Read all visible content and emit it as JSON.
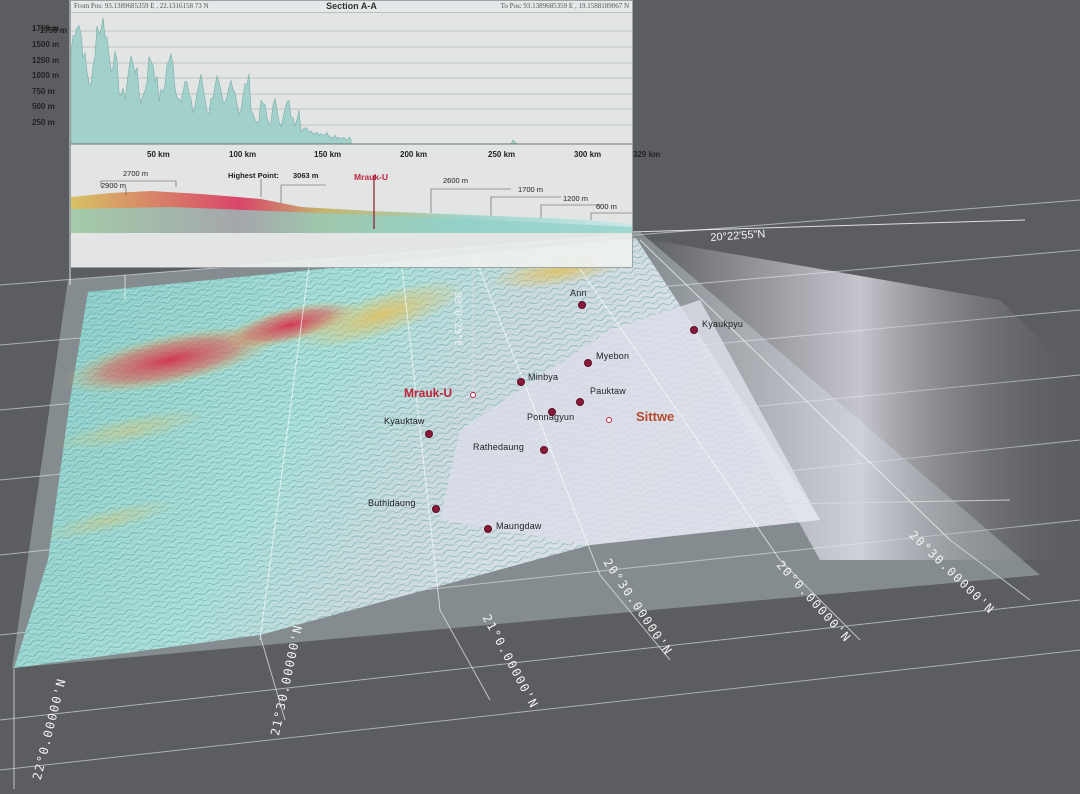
{
  "panel": {
    "from_pos": "From Pos: 93.1389685359 E , 22.1316158 73 N",
    "title": "Section A-A",
    "to_pos": "To Pos: 93.1389685359 E , 19.1588189067 N",
    "elevation_ticks": [
      "1750 m",
      "1500 m",
      "1250 m",
      "1000 m",
      "750 m",
      "500 m",
      "250 m"
    ],
    "distance_ticks": [
      "50 km",
      "100 km",
      "150 km",
      "200 km",
      "250 km",
      "300 km",
      "329 km"
    ]
  },
  "strip": {
    "labels": {
      "l2700": "2700 m",
      "l2900": "2900 m",
      "highest": "Highest Point:",
      "highest_value": "3063 m",
      "mrauk": "Mrauk-U",
      "l2600": "2600 m",
      "l1700": "1700 m",
      "l1200": "1200 m",
      "l600": "600 m"
    }
  },
  "map": {
    "towns": [
      {
        "name": "Ann"
      },
      {
        "name": "Kyaukpyu"
      },
      {
        "name": "Myebon"
      },
      {
        "name": "Minbya"
      },
      {
        "name": "Pauktaw"
      },
      {
        "name": "Ponnagyun"
      },
      {
        "name": "Kyauktaw"
      },
      {
        "name": "Rathedaung"
      },
      {
        "name": "Buthidaung"
      },
      {
        "name": "Maungdaw"
      }
    ],
    "mrauk_u": "Mrauk-U",
    "sittwe": "Sittwe",
    "longitude_label": "93°8'29\"E",
    "latitude_right": "20°22'55\"N",
    "grid_labels": [
      "22°0.00000'N",
      "21°30.00000'N",
      "21°0.00000'N",
      "20°30.00000'N",
      "20°0.00000'N",
      "20°30.00000'N"
    ]
  },
  "colors": {
    "background": "#5b5d60",
    "terrain_low": "#8fd4cf",
    "terrain_mid": "#d8c56a",
    "terrain_high": "#d2324e",
    "sea": "#d6d8e4",
    "town_dot": "#8a1838",
    "highlight": "#c0243c"
  }
}
